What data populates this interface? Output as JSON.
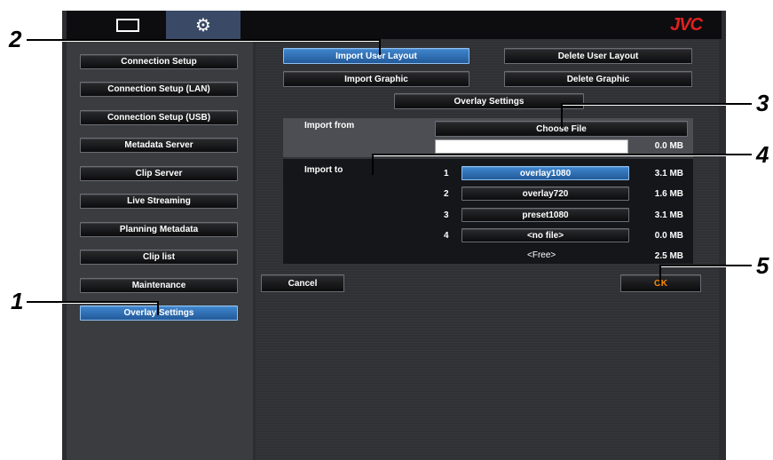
{
  "brand": "JVC",
  "tabs": [
    {
      "icon": "monitor-icon"
    },
    {
      "icon": "gear-icon"
    }
  ],
  "sidebar": {
    "items": [
      {
        "label": "Connection Setup"
      },
      {
        "label": "Connection Setup (LAN)"
      },
      {
        "label": "Connection Setup (USB)"
      },
      {
        "label": "Metadata Server"
      },
      {
        "label": "Clip Server"
      },
      {
        "label": "Live Streaming"
      },
      {
        "label": "Planning Metadata"
      },
      {
        "label": "Clip list"
      },
      {
        "label": "Maintenance"
      },
      {
        "label": "Overlay Settings"
      }
    ]
  },
  "toolbar": {
    "import_user_layout": "Import User Layout",
    "delete_user_layout": "Delete User Layout",
    "import_graphic": "Import Graphic",
    "delete_graphic": "Delete Graphic",
    "overlay_settings": "Overlay Settings"
  },
  "import_from": {
    "label": "Import from",
    "choose_file": "Choose File",
    "file_value": "",
    "size": "0.0 MB"
  },
  "import_to": {
    "label": "Import to",
    "slots": [
      {
        "num": "1",
        "name": "overlay1080",
        "size": "3.1 MB"
      },
      {
        "num": "2",
        "name": "overlay720",
        "size": "1.6 MB"
      },
      {
        "num": "3",
        "name": "preset1080",
        "size": "3.1 MB"
      },
      {
        "num": "4",
        "name": "<no file>",
        "size": "0.0 MB"
      }
    ],
    "free_label": "<Free>",
    "free_size": "2.5 MB"
  },
  "actions": {
    "cancel": "Cancel",
    "ok": "OK"
  },
  "callouts": {
    "c1": "1",
    "c2": "2",
    "c3": "3",
    "c4": "4",
    "c5": "5"
  },
  "colors": {
    "accent": "#2e6db4",
    "brand": "#e02020",
    "ok_text": "#ff8a00"
  }
}
